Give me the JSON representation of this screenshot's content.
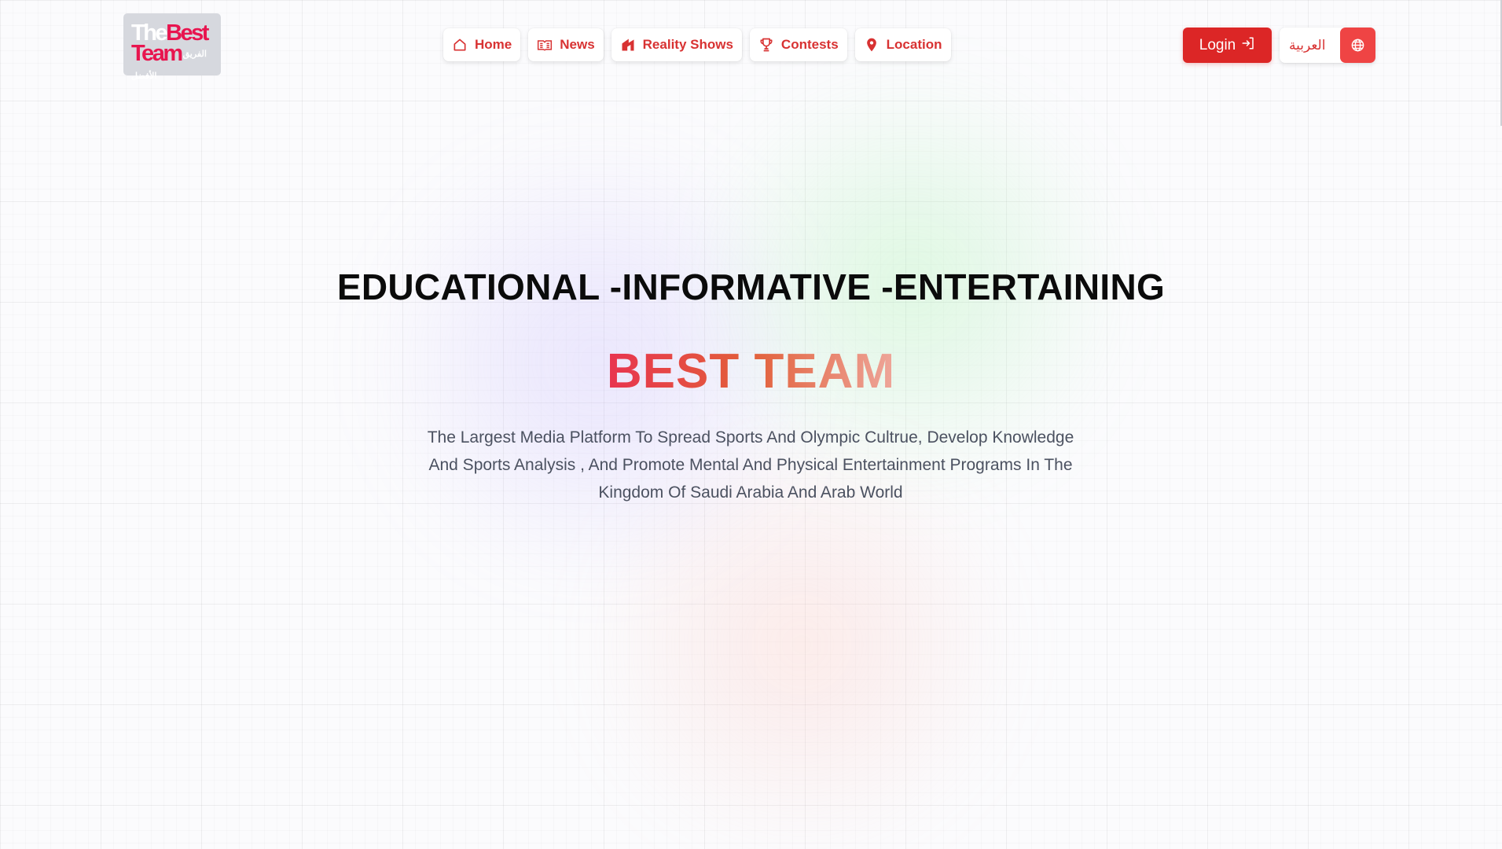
{
  "header": {
    "logo": {
      "line1_a": "The",
      "line1_b": "Best",
      "line2_a": "Team",
      "line2_arabic": "الفريق الأفضل"
    },
    "nav": [
      {
        "label": "Home",
        "icon": "home-icon"
      },
      {
        "label": "News",
        "icon": "newspaper-icon"
      },
      {
        "label": "Reality Shows",
        "icon": "reality-shows-icon"
      },
      {
        "label": "Contests",
        "icon": "trophy-icon"
      },
      {
        "label": "Location",
        "icon": "map-pin-icon"
      }
    ],
    "login_label": "Login",
    "language_label": "العربية"
  },
  "hero": {
    "headline": "EDUCATIONAL -INFORMATIVE -ENTERTAINING",
    "brand": "BEST TEAM",
    "description": "The Largest Media Platform To Spread Sports And Olympic Cultrue, Develop Knowledge And Sports Analysis , And Promote Mental And Physical Entertainment Programs In The Kingdom Of Saudi Arabia And Arab World"
  },
  "colors": {
    "accent": "#dc2626",
    "nav_text": "#d83232",
    "logo_red": "#e8154f",
    "logo_bg": "#d6d8de",
    "brand_gradient": [
      "#e8344f",
      "#e2603a",
      "#eea69a"
    ]
  }
}
